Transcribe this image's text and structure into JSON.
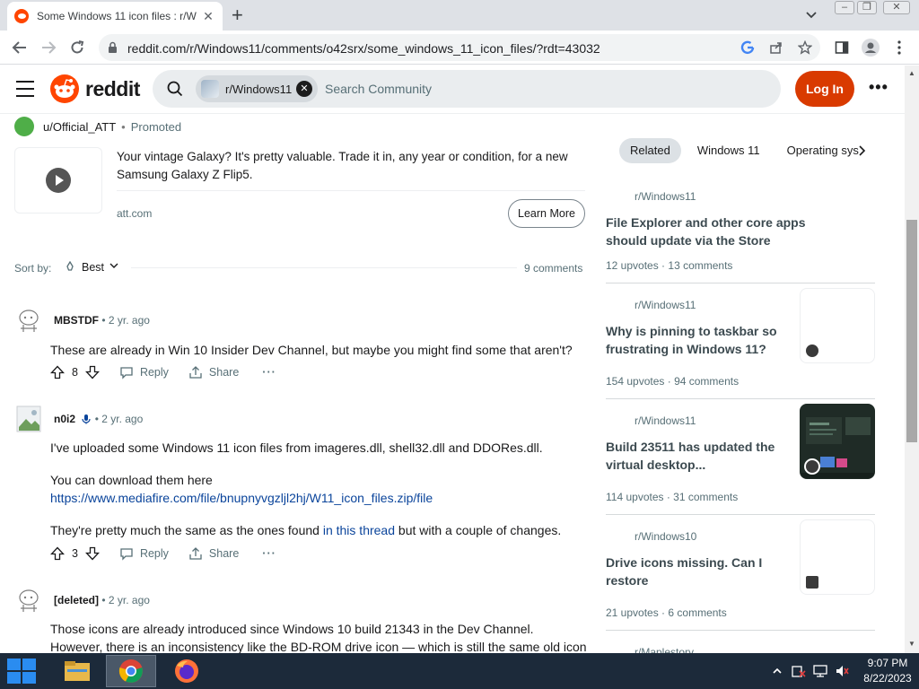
{
  "browser": {
    "tab_title": "Some Windows 11 icon files : r/W",
    "url": "reddit.com/r/Windows11/comments/o42srx/some_windows_11_icon_files/?rdt=43032",
    "new_tab": "+",
    "close_tab": "✕"
  },
  "header": {
    "logo_text": "reddit",
    "search_chip": "r/Windows11",
    "search_placeholder": "Search Community",
    "login": "Log In",
    "more": "•••"
  },
  "promo": {
    "user": "u/Official_ATT",
    "tag": "Promoted",
    "text": "Your vintage Galaxy? It's pretty valuable. Trade it in, any year or condition, for a new Samsung Galaxy Z Flip5.",
    "domain": "att.com",
    "cta": "Learn More"
  },
  "sort": {
    "label": "Sort by:",
    "value": "Best",
    "count": "9 comments"
  },
  "comments": [
    {
      "user": "MBSTDF",
      "age": "2 yr. ago",
      "body": "These are already in Win 10 Insider Dev Channel, but maybe you might find some that aren't?",
      "votes": "8",
      "reply": "Reply",
      "share": "Share"
    },
    {
      "user": "n0i2",
      "age": "2 yr. ago",
      "p1": "I've uploaded some Windows 11 icon files from imageres.dll, shell32.dll and DDORes.dll.",
      "p2": "You can download them here",
      "link": "https://www.mediafire.com/file/bnupnyvgzljl2hj/W11_icon_files.zip/file",
      "p3a": "They're pretty much the same as the ones found ",
      "p3link": "in this thread",
      "p3b": " but with a couple of changes.",
      "votes": "3",
      "reply": "Reply",
      "share": "Share"
    },
    {
      "user": "[deleted]",
      "age": "2 yr. ago",
      "body": "Those icons are already introduced since Windows 10 build 21343 in the Dev Channel. However, there is an inconsistency like the BD-ROM drive icon — which is still the same old icon"
    }
  ],
  "sidebar": {
    "pills": [
      "Related",
      "Windows 11",
      "Operating sys"
    ],
    "posts": [
      {
        "sub": "r/Windows11",
        "title": "File Explorer and other core apps should update via the Store",
        "upvotes": "12 upvotes",
        "comments": "13 comments"
      },
      {
        "sub": "r/Windows11",
        "title": "Why is pinning to taskbar so frustrating in Windows 11?",
        "upvotes": "154 upvotes",
        "comments": "94 comments"
      },
      {
        "sub": "r/Windows11",
        "title": "Build 23511 has updated the virtual desktop...",
        "upvotes": "114 upvotes",
        "comments": "31 comments"
      },
      {
        "sub": "r/Windows10",
        "title": "Drive icons missing. Can I restore",
        "upvotes": "21 upvotes",
        "comments": "6 comments"
      },
      {
        "sub": "r/Maplestory"
      }
    ]
  },
  "taskbar": {
    "time": "9:07 PM",
    "date": "8/22/2023"
  },
  "colors": {
    "accent": "#ff4500",
    "login": "#d93a00",
    "link": "#0a449b"
  }
}
